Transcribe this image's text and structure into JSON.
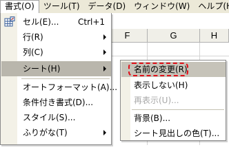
{
  "menubar": {
    "items": [
      {
        "label": "書式(O)",
        "active": true
      },
      {
        "label": "ツール(T)",
        "active": false
      },
      {
        "label": "データ(D)",
        "active": false
      },
      {
        "label": "ウィンドウ(W)",
        "active": false
      },
      {
        "label": "ヘルプ(H)",
        "active": false
      }
    ]
  },
  "sheet": {
    "columns": [
      "F",
      "G",
      "H"
    ]
  },
  "format_menu": {
    "icon": "format-cells-icon",
    "items": [
      {
        "label": "セル(E)...",
        "shortcut": "Ctrl+1",
        "submenu": false
      },
      {
        "label": "行(R)",
        "submenu": true
      },
      {
        "label": "列(C)",
        "submenu": true
      },
      {
        "label": "シート(H)",
        "submenu": true,
        "highlighted": true
      },
      {
        "label": "オートフォーマット(A)...",
        "submenu": false
      },
      {
        "label": "条件付き書式(D)...",
        "submenu": false
      },
      {
        "label": "スタイル(S)...",
        "submenu": false
      },
      {
        "label": "ふりがな(T)",
        "submenu": true
      }
    ]
  },
  "sheet_submenu": {
    "items": [
      {
        "label": "名前の変更(R)",
        "highlighted": true
      },
      {
        "label": "表示しない(H)"
      },
      {
        "label": "再表示(U)...",
        "disabled": true
      },
      {
        "label": "背景(B)..."
      },
      {
        "label": "シート見出しの色(T)..."
      }
    ],
    "annotation_color": "#e0101a"
  },
  "colors": {
    "menubar_bg": "#ece9d8",
    "highlight": "#b9b6ac"
  }
}
